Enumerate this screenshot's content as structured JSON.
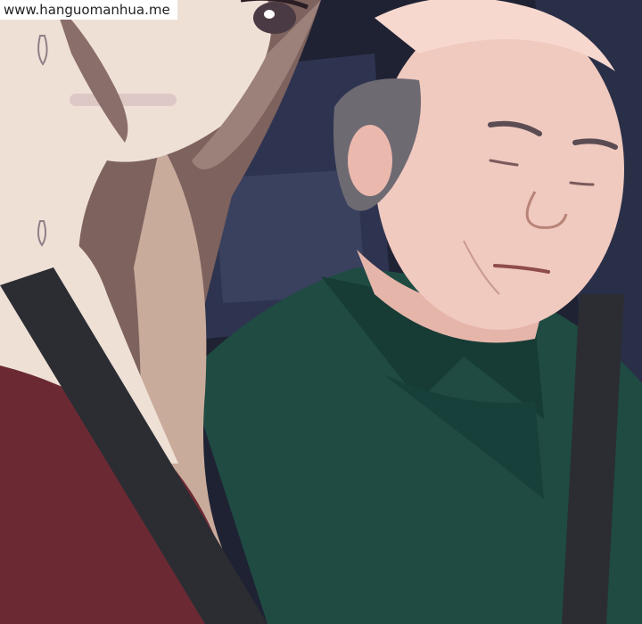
{
  "watermark": {
    "text": "www.hanguomanhua.me"
  },
  "colors": {
    "car_interior_dark": "#1f2233",
    "seat_blue": "#3a415e",
    "woman_hair": "#8a6e6a",
    "woman_hair_light": "#c9ab9b",
    "woman_skin": "#efe0d6",
    "woman_top": "#6b2a33",
    "man_skin": "#f0c9bf",
    "man_hair_gray": "#6e6a72",
    "man_shirt": "#1f4b43",
    "seatbelt": "#2b2d33"
  }
}
